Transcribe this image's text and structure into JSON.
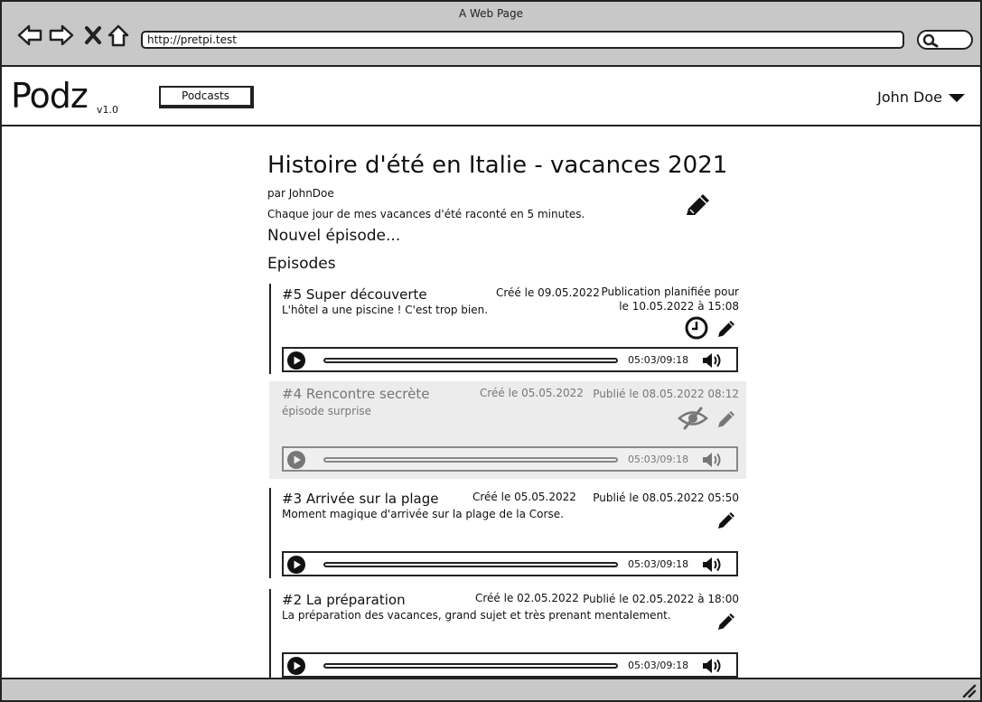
{
  "browser": {
    "window_title": "A Web Page",
    "url": "http://pretpi.test"
  },
  "app": {
    "logo": "Podz",
    "version": "v1.0",
    "nav_podcasts": "Podcasts",
    "user_name": "John Doe"
  },
  "podcast": {
    "title": "Histoire d'été en Italie - vacances 2021",
    "author": "par JohnDoe",
    "description": "Chaque jour de mes vacances d'été raconté en 5 minutes.",
    "new_episode_link": "Nouvel épisode...",
    "episodes_heading": "Episodes"
  },
  "episodes": [
    {
      "title": "#5 Super découverte",
      "description": "L'hôtel a une piscine ! C'est trop bien.",
      "created": "Créé le 09.05.2022",
      "status_line1": "Publication planifiée pour",
      "status_line2": "le 10.05.2022 à 15:08",
      "time": "05:03/09:18",
      "icons": [
        "clock-icon",
        "pencil-icon"
      ],
      "hidden": false
    },
    {
      "title": "#4 Rencontre secrète",
      "description": "épisode surprise",
      "created": "Créé le 05.05.2022",
      "status_line1": "Publié le 08.05.2022 08:12",
      "status_line2": "",
      "time": "05:03/09:18",
      "icons": [
        "eye-slash-icon",
        "pencil-icon"
      ],
      "hidden": true
    },
    {
      "title": "#3 Arrivée sur la plage",
      "description": "Moment magique d'arrivée sur la plage de la Corse.",
      "created": "Créé le 05.05.2022",
      "status_line1": "Publié le 08.05.2022 05:50",
      "status_line2": "",
      "time": "05:03/09:18",
      "icons": [
        "pencil-icon"
      ],
      "hidden": false
    },
    {
      "title": "#2 La préparation",
      "description": "La préparation des vacances, grand sujet et très prenant mentalement.",
      "created": "Créé le 02.05.2022",
      "status_line1": "Publié le 02.05.2022 à 18:00",
      "status_line2": "",
      "time": "05:03/09:18",
      "icons": [
        "pencil-icon"
      ],
      "hidden": false
    }
  ],
  "colors": {
    "chrome_gray": "#c8c8c8",
    "hidden_episode_bg": "#ececec",
    "ink": "#222222"
  }
}
